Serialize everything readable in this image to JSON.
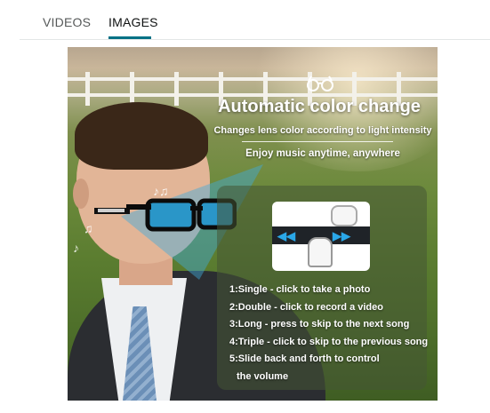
{
  "tabs": [
    {
      "label": "VIDEOS",
      "selected": false
    },
    {
      "label": "IMAGES",
      "selected": true
    }
  ],
  "colors": {
    "accent_underline": "#007185",
    "tab_inactive": "#565959",
    "tab_active": "#0f1111",
    "lens_blue": "#2aa7e8"
  },
  "promo": {
    "headline": "Automatic color change",
    "subheadline": "Changes lens color according to light intensity",
    "music_line": "Enjoy music anytime, anywhere",
    "icons": [
      "glasses-icon",
      "music-notes-icon",
      "touch-gesture-icon"
    ],
    "instructions": [
      "1:Single - click to take a photo",
      "2:Double - click to record a video",
      "3:Long - press to skip to the next song",
      "4:Triple - click to skip to the previous song",
      "5:Slide back and forth to control",
      "the volume"
    ]
  }
}
